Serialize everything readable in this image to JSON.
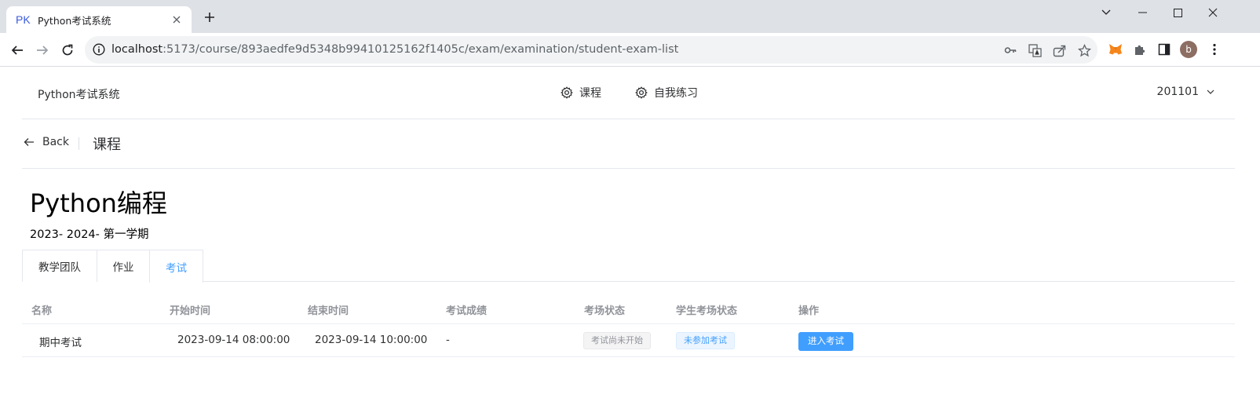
{
  "browser": {
    "tab": {
      "favicon_text": "PK",
      "title": "Python考试系统"
    },
    "url": {
      "host": "localhost",
      "rest": ":5173/course/893aedfe9d5348b99410125162f1405c/exam/examination/student-exam-list"
    },
    "profile_initial": "b"
  },
  "header": {
    "brand": "Python考试系统",
    "menu": [
      {
        "label": "课程",
        "icon": "gear-icon"
      },
      {
        "label": "自我练习",
        "icon": "gear-icon"
      }
    ],
    "user": "201101"
  },
  "page_header": {
    "back_label": "Back",
    "title": "课程"
  },
  "course": {
    "title": "Python编程",
    "term": "2023- 2024- 第一学期"
  },
  "tabs": [
    {
      "label": "教学团队",
      "active": false
    },
    {
      "label": "作业",
      "active": false
    },
    {
      "label": "考试",
      "active": true
    }
  ],
  "table": {
    "columns": [
      "名称",
      "开始时间",
      "结束时间",
      "考试成绩",
      "考场状态",
      "学生考场状态",
      "操作"
    ],
    "rows": [
      {
        "name": "期中考试",
        "start": "2023-09-14 08:00:00",
        "end": "2023-09-14 10:00:00",
        "score": "-",
        "room_status": "考试尚未开始",
        "student_status": "未参加考试",
        "action": "进入考试"
      }
    ]
  },
  "colors": {
    "accent": "#409eff",
    "muted": "#909399",
    "tab_bar": "#dee1e6"
  }
}
